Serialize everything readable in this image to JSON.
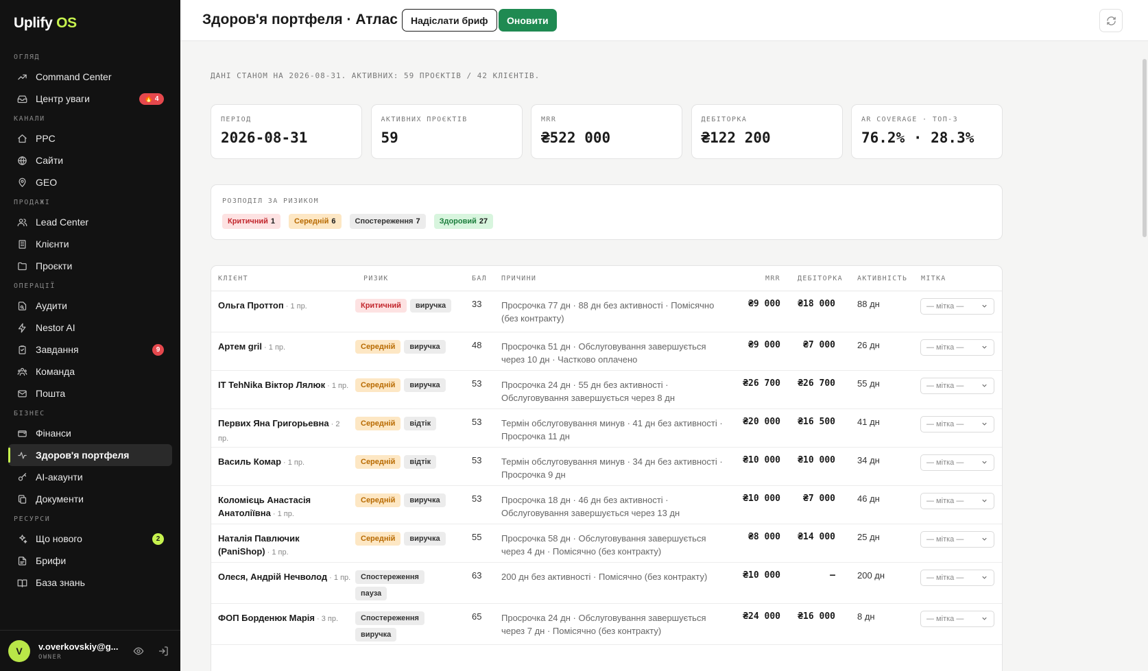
{
  "app": {
    "logo_main": "Uplify",
    "logo_accent": "OS"
  },
  "sidebar": {
    "sections": [
      {
        "label": "ОГЛЯД",
        "items": [
          {
            "label": "Command Center",
            "icon": "trending-up-icon"
          },
          {
            "label": "Центр уваги",
            "icon": "inbox-icon",
            "badge": "🔥 4",
            "badge_color": "red"
          }
        ]
      },
      {
        "label": "КАНАЛИ",
        "items": [
          {
            "label": "PPC",
            "icon": "home-icon"
          },
          {
            "label": "Сайти",
            "icon": "globe-icon"
          },
          {
            "label": "GEO",
            "icon": "map-pin-icon"
          }
        ]
      },
      {
        "label": "ПРОДАЖІ",
        "items": [
          {
            "label": "Lead Center",
            "icon": "users-icon"
          },
          {
            "label": "Клієнти",
            "icon": "building-icon"
          },
          {
            "label": "Проєкти",
            "icon": "folder-icon"
          }
        ]
      },
      {
        "label": "ОПЕРАЦІЇ",
        "items": [
          {
            "label": "Аудити",
            "icon": "file-search-icon"
          },
          {
            "label": "Nestor AI",
            "icon": "bolt-icon"
          },
          {
            "label": "Завдання",
            "icon": "clipboard-icon",
            "badge": "9",
            "badge_color": "red"
          },
          {
            "label": "Команда",
            "icon": "team-icon"
          },
          {
            "label": "Пошта",
            "icon": "mail-icon"
          }
        ]
      },
      {
        "label": "БІЗНЕС",
        "items": [
          {
            "label": "Фінанси",
            "icon": "wallet-icon"
          },
          {
            "label": "Здоров'я портфеля",
            "icon": "pulse-icon",
            "active": true
          },
          {
            "label": "AI-акаунти",
            "icon": "key-icon"
          },
          {
            "label": "Документи",
            "icon": "copy-icon"
          }
        ]
      },
      {
        "label": "РЕСУРСИ",
        "items": [
          {
            "label": "Що нового",
            "icon": "sparkles-icon",
            "badge": "2",
            "badge_color": "lime"
          },
          {
            "label": "Брифи",
            "icon": "doc-icon"
          },
          {
            "label": "База знань",
            "icon": "book-icon"
          }
        ]
      }
    ],
    "user": {
      "initial": "V",
      "email": "v.overkovskiy@g...",
      "role": "OWNER"
    }
  },
  "header": {
    "title": "Здоров'я портфеля · Атлас",
    "send_brief": "Надіслати бриф",
    "refresh": "Оновити"
  },
  "asof": "ДАНІ СТАНОМ НА 2026-08-31. АКТИВНИХ: 59 ПРОЄКТІВ / 42 КЛІЄНТІВ.",
  "kpis": [
    {
      "label": "ПЕРІОД",
      "value": "2026-08-31"
    },
    {
      "label": "АКТИВНИХ ПРОЄКТІВ",
      "value": "59"
    },
    {
      "label": "MRR",
      "value": "₴522 000"
    },
    {
      "label": "ДЕБІТОРКА",
      "value": "₴122 200"
    },
    {
      "label": "AR COVERAGE · ТОП-3",
      "value": "76.2% · 28.3%"
    }
  ],
  "risk_distribution": {
    "label": "РОЗПОДІЛ ЗА РИЗИКОМ",
    "items": [
      {
        "name": "Критичний",
        "count": "1",
        "level": "crit"
      },
      {
        "name": "Середній",
        "count": "6",
        "level": "mid"
      },
      {
        "name": "Спостереження",
        "count": "7",
        "level": "watch"
      },
      {
        "name": "Здоровий",
        "count": "27",
        "level": "healthy"
      }
    ]
  },
  "table": {
    "columns": {
      "client": "КЛІЄНТ",
      "risk": "РИЗИК",
      "score": "БАЛ",
      "reasons": "ПРИЧИНИ",
      "mrr": "MRR",
      "ar": "ДЕБІТОРКА",
      "activity": "АКТИВНІСТЬ",
      "mark": "МІТКА"
    },
    "mark_placeholder": "— мітка —",
    "rows": [
      {
        "client": "Ольга Проттоп",
        "projects": "· 1 пр.",
        "risk": "Критичний",
        "level": "crit",
        "kind": "виручка",
        "score": "33",
        "reasons": "Просрочка 77 дн · 88 дн без активності · Помісячно (без контракту)",
        "mrr": "₴9 000",
        "ar": "₴18 000",
        "activity": "88 дн",
        "height": 60
      },
      {
        "client": "Артем gril",
        "projects": "· 1 пр.",
        "risk": "Середній",
        "level": "mid",
        "kind": "виручка",
        "score": "48",
        "reasons": "Просрочка 51 дн · Обслуговування завершується через 10 дн · Частково оплачено",
        "mrr": "₴9 000",
        "ar": "₴7 000",
        "activity": "26 дн",
        "height": 56
      },
      {
        "client": "IT TehNika Віктор Лялюк",
        "projects": "· 1 пр.",
        "risk": "Середній",
        "level": "mid",
        "kind": "виручка",
        "score": "53",
        "reasons": "Просрочка 24 дн · 55 дн без активності · Обслуговування завершується через 8 дн",
        "mrr": "₴26 700",
        "ar": "₴26 700",
        "activity": "55 дн",
        "height": 56
      },
      {
        "client": "Первих Яна Григорьевна",
        "projects": "· 2 пр.",
        "risk": "Середній",
        "level": "mid",
        "kind": "відтік",
        "score": "53",
        "reasons": "Термін обслуговування минув · 41 дн без активності · Просрочка 11 дн",
        "mrr": "₴20 000",
        "ar": "₴16 500",
        "activity": "41 дн",
        "height": 56
      },
      {
        "client": "Василь Комар",
        "projects": "· 1 пр.",
        "risk": "Середній",
        "level": "mid",
        "kind": "відтік",
        "score": "53",
        "reasons": "Термін обслуговування минув · 34 дн без активності · Просрочка 9 дн",
        "mrr": "₴10 000",
        "ar": "₴10 000",
        "activity": "34 дн",
        "height": 56
      },
      {
        "client": "Коломієць Анастасія Анатоліївна",
        "projects": "· 1 пр.",
        "risk": "Середній",
        "level": "mid",
        "kind": "виручка",
        "score": "53",
        "reasons": "Просрочка 18 дн · 46 дн без активності · Обслуговування завершується через 13 дн",
        "mrr": "₴10 000",
        "ar": "₴7 000",
        "activity": "46 дн",
        "height": 56
      },
      {
        "client": "Наталія Павлючик (PaniShop)",
        "projects": "· 1 пр.",
        "risk": "Середній",
        "level": "mid",
        "kind": "виручка",
        "score": "55",
        "reasons": "Просрочка 58 дн · Обслуговування завершується через 4 дн · Помісячно (без контракту)",
        "mrr": "₴8 000",
        "ar": "₴14 000",
        "activity": "25 дн",
        "height": 56
      },
      {
        "client": "Олеся, Андрій Нечволод",
        "projects": "· 1 пр.",
        "risk": "Спостереження",
        "level": "watch",
        "kind": "пауза",
        "score": "63",
        "reasons": "200 дн без активності · Помісячно (без контракту)",
        "mrr": "₴10 000",
        "ar": "–",
        "activity": "200 дн",
        "height": 60
      },
      {
        "client": "ФОП Борденюк Марія",
        "projects": "· 3 пр.",
        "risk": "Спостереження",
        "level": "watch",
        "kind": "виручка",
        "score": "65",
        "reasons": "Просрочка 24 дн · Обслуговування завершується через 7 дн · Помісячно (без контракту)",
        "mrr": "₴24 000",
        "ar": "₴16 000",
        "activity": "8 дн",
        "height": 60
      }
    ]
  }
}
